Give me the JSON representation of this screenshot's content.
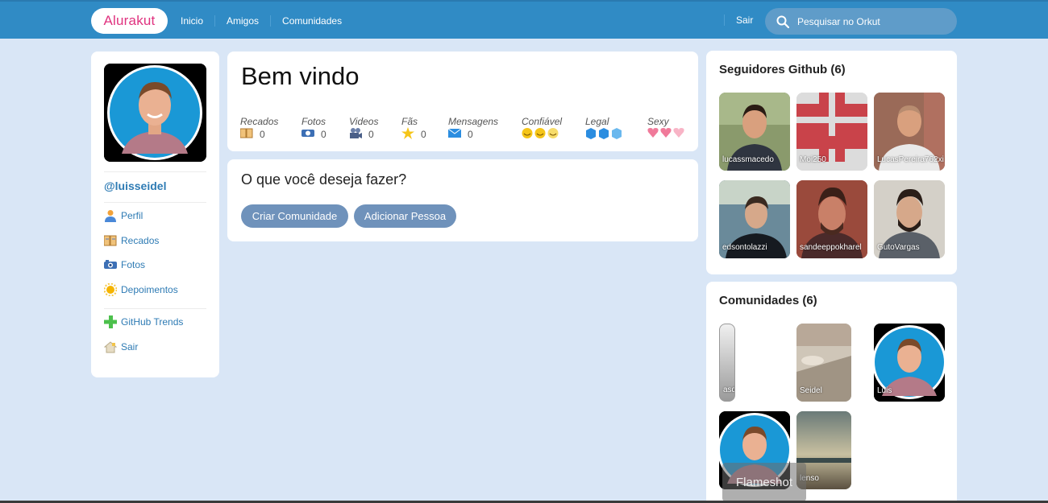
{
  "header": {
    "logo": "Alurakut",
    "nav": [
      "Inicio",
      "Amigos",
      "Comunidades"
    ],
    "logout": "Sair",
    "search_placeholder": "Pesquisar no Orkut"
  },
  "sidebar": {
    "username": "@luisseidel",
    "items": [
      {
        "label": "Perfil",
        "icon": "user-icon"
      },
      {
        "label": "Recados",
        "icon": "notebook-icon"
      },
      {
        "label": "Fotos",
        "icon": "camera-icon"
      },
      {
        "label": "Depoimentos",
        "icon": "sun-icon"
      },
      {
        "label": "GitHub Trends",
        "icon": "plus-icon"
      },
      {
        "label": "Sair",
        "icon": "home-icon"
      }
    ]
  },
  "welcome": {
    "title": "Bem vindo",
    "stats": [
      {
        "label": "Recados",
        "value": "0",
        "icon": "notebook-icon"
      },
      {
        "label": "Fotos",
        "value": "0",
        "icon": "camera-icon"
      },
      {
        "label": "Videos",
        "value": "0",
        "icon": "video-camera-icon"
      },
      {
        "label": "Fãs",
        "value": "0",
        "icon": "star-icon"
      },
      {
        "label": "Mensagens",
        "value": "0",
        "icon": "envelope-icon"
      },
      {
        "label": "Confiável",
        "icon": "smiley-icon"
      },
      {
        "label": "Legal",
        "icon": "cube-icon"
      },
      {
        "label": "Sexy",
        "icon": "heart-icon"
      }
    ]
  },
  "actions": {
    "question": "O que você deseja fazer?",
    "buttons": [
      "Criar Comunidade",
      "Adicionar Pessoa"
    ]
  },
  "followers": {
    "title": "Seguidores Github (6)",
    "items": [
      "lucassmacedo",
      "Moi250",
      "LucasPereira762xi",
      "edsontolazzi",
      "sandeeppokharel",
      "GutoVargas"
    ]
  },
  "communities": {
    "title": "Comunidades (6)",
    "items": [
      "asd",
      "Seidel",
      "Luis",
      "",
      "lenso"
    ]
  },
  "overlay": {
    "label": "Flameshot"
  },
  "colors": {
    "header": "#308bc5",
    "background": "#d9e6f6",
    "link": "#2e7bb4",
    "button": "#6f92bb",
    "logo": "#e0327f"
  }
}
